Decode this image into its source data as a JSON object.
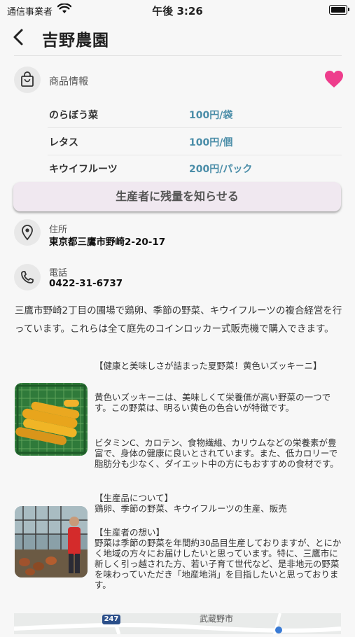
{
  "status_bar": {
    "carrier": "通信事業者",
    "time": "午後 3:26"
  },
  "nav": {
    "title": "吉野農園"
  },
  "products": {
    "label": "商品情報",
    "items": [
      {
        "name": "のらぼう菜",
        "price": "100円/袋"
      },
      {
        "name": "レタス",
        "price": "100円/個"
      },
      {
        "name": "キウイフルーツ",
        "price": "200円/パック"
      }
    ]
  },
  "notify_button": "生産者に残量を知らせる",
  "address": {
    "label": "住所",
    "value": "東京都三鷹市野崎2-20-17"
  },
  "phone": {
    "label": "電話",
    "value": "0422-31-6737"
  },
  "description": "三鷹市野崎2丁目の圃場で鶏卵、季節の野菜、キウイフルーツの複合経営を行っています。これらは全て庭先のコインロッカー式販売機で購入できます。",
  "article1": {
    "heading": "【健康と美味しさが詰まった夏野菜！黄色いズッキーニ】",
    "para1": "黄色いズッキーニは、美味しくて栄養価が高い野菜の一つです。この野菜は、明るい黄色の色合いが特徴です。",
    "para2": "ビタミンC、カロテン、食物繊維、カリウムなどの栄養素が豊富で、身体の健康に良いとされています。また、低カロリーで脂肪分も少なく、ダイエット中の方にもおすすめの食材です。"
  },
  "article2": {
    "heading1": "【生産品について】",
    "text1": "鶏卵、季節の野菜、キウイフルーツの生産、販売",
    "heading2": "【生産者の想い】",
    "text2": "野菜は季節の野菜を年間約30品目生産しておりますが、とにかく地域の方々にお届けしたいと思っています。特に、三鷹市に新しく引っ越された方、若い子育て世代など、是非地元の野菜を味わっていただき「地産地消」を目指したいと思っております。"
  },
  "map": {
    "road_number": "247",
    "place_label": "武蔵野市"
  },
  "colors": {
    "heart": "#ee3d8c",
    "price": "#4a8da8",
    "button_bg": "#f0e8f0"
  }
}
